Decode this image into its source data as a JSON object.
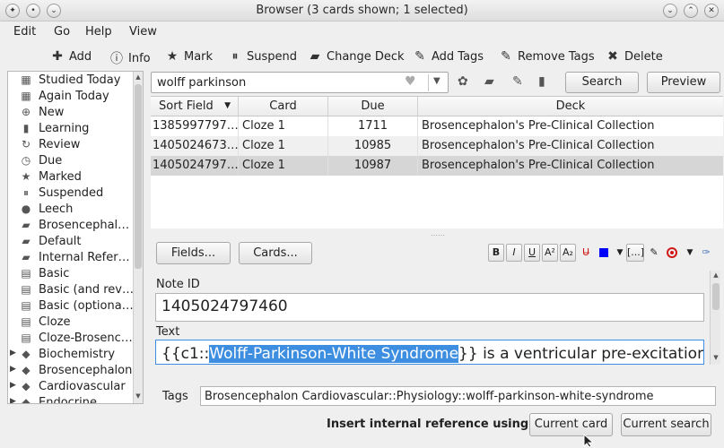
{
  "window": {
    "title": "Browser (3 cards shown; 1 selected)"
  },
  "menu": [
    "Edit",
    "Go",
    "Help",
    "View"
  ],
  "toolbar": {
    "add": "Add",
    "info": "Info",
    "mark": "Mark",
    "suspend": "Suspend",
    "change_deck": "Change Deck",
    "add_tags": "Add Tags",
    "remove_tags": "Remove Tags",
    "delete": "Delete"
  },
  "sidebar": {
    "items": [
      {
        "label": "Studied Today",
        "icon": "calendar-icon"
      },
      {
        "label": "Again Today",
        "icon": "calendar-icon"
      },
      {
        "label": "New",
        "icon": "plus-circle-icon"
      },
      {
        "label": "Learning",
        "icon": "book-icon"
      },
      {
        "label": "Review",
        "icon": "review-icon"
      },
      {
        "label": "Due",
        "icon": "clock-icon"
      },
      {
        "label": "Marked",
        "icon": "star-icon"
      },
      {
        "label": "Suspended",
        "icon": "pause-icon"
      },
      {
        "label": "Leech",
        "icon": "leech-icon"
      },
      {
        "label": "Brosencephal…",
        "icon": "deck-icon"
      },
      {
        "label": "Default",
        "icon": "deck-icon"
      },
      {
        "label": "Internal Refer…",
        "icon": "deck-icon"
      },
      {
        "label": "Basic",
        "icon": "note-type-icon"
      },
      {
        "label": "Basic (and rev…",
        "icon": "note-type-icon"
      },
      {
        "label": "Basic (optiona…",
        "icon": "note-type-icon"
      },
      {
        "label": "Cloze",
        "icon": "note-type-icon"
      },
      {
        "label": "Cloze-Brosenc…",
        "icon": "note-type-icon"
      },
      {
        "label": "Biochemistry",
        "icon": "tag-icon"
      },
      {
        "label": "Brosencephalon",
        "icon": "tag-icon"
      },
      {
        "label": "Cardiovascular",
        "icon": "tag-icon"
      },
      {
        "label": "Endocrine",
        "icon": "tag-icon"
      }
    ]
  },
  "search": {
    "value": "wolff parkinson",
    "search_label": "Search",
    "preview_label": "Preview"
  },
  "table": {
    "columns": [
      "Sort Field",
      "Card",
      "Due",
      "Deck"
    ],
    "rows": [
      {
        "sort": "1385997797…",
        "card": "Cloze 1",
        "due": "1711",
        "deck": "Brosencephalon's Pre-Clinical Collection"
      },
      {
        "sort": "1405024673…",
        "card": "Cloze 1",
        "due": "10985",
        "deck": "Brosencephalon's Pre-Clinical Collection"
      },
      {
        "sort": "1405024797…",
        "card": "Cloze 1",
        "due": "10987",
        "deck": "Brosencephalon's Pre-Clinical Collection"
      }
    ]
  },
  "editor": {
    "fields_button": "Fields...",
    "cards_button": "Cards...",
    "format_buttons": [
      "B",
      "I",
      "U",
      "A²",
      "A₂"
    ],
    "html_button": "[...]",
    "note_id_label": "Note ID",
    "note_id_value": "1405024797460",
    "text_label": "Text",
    "text_prefix": "{{c1::",
    "text_selected": "Wolff-Parkinson-White Syndrome",
    "text_suffix": "}} is a ventricular pre-excitation",
    "tags_label": "Tags",
    "tags_value": "Brosencephalon Cardiovascular::Physiology::wolff-parkinson-white-syndrome"
  },
  "footer": {
    "insert_label": "Insert internal reference using:",
    "current_card": "Current card",
    "current_search": "Current search"
  },
  "colors": {
    "selection": "#3d8ee0",
    "row_selected": "#d6d6d6",
    "row_alt": "#f0f0f0",
    "record_red": "#d01818",
    "color_blue": "#0000ff"
  }
}
